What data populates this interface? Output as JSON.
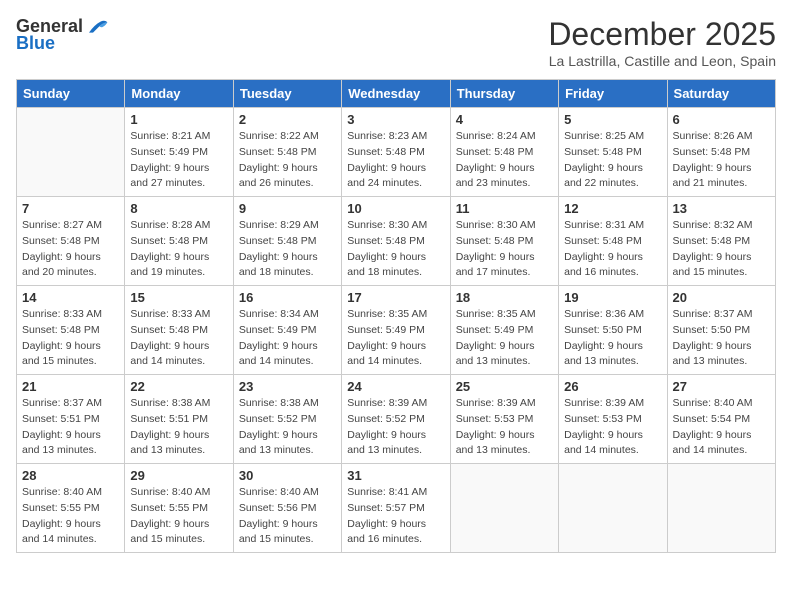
{
  "header": {
    "logo_general": "General",
    "logo_blue": "Blue",
    "month_title": "December 2025",
    "subtitle": "La Lastrilla, Castille and Leon, Spain"
  },
  "days_of_week": [
    "Sunday",
    "Monday",
    "Tuesday",
    "Wednesday",
    "Thursday",
    "Friday",
    "Saturday"
  ],
  "weeks": [
    [
      {
        "day": "",
        "info": ""
      },
      {
        "day": "1",
        "info": "Sunrise: 8:21 AM\nSunset: 5:49 PM\nDaylight: 9 hours\nand 27 minutes."
      },
      {
        "day": "2",
        "info": "Sunrise: 8:22 AM\nSunset: 5:48 PM\nDaylight: 9 hours\nand 26 minutes."
      },
      {
        "day": "3",
        "info": "Sunrise: 8:23 AM\nSunset: 5:48 PM\nDaylight: 9 hours\nand 24 minutes."
      },
      {
        "day": "4",
        "info": "Sunrise: 8:24 AM\nSunset: 5:48 PM\nDaylight: 9 hours\nand 23 minutes."
      },
      {
        "day": "5",
        "info": "Sunrise: 8:25 AM\nSunset: 5:48 PM\nDaylight: 9 hours\nand 22 minutes."
      },
      {
        "day": "6",
        "info": "Sunrise: 8:26 AM\nSunset: 5:48 PM\nDaylight: 9 hours\nand 21 minutes."
      }
    ],
    [
      {
        "day": "7",
        "info": "Sunrise: 8:27 AM\nSunset: 5:48 PM\nDaylight: 9 hours\nand 20 minutes."
      },
      {
        "day": "8",
        "info": "Sunrise: 8:28 AM\nSunset: 5:48 PM\nDaylight: 9 hours\nand 19 minutes."
      },
      {
        "day": "9",
        "info": "Sunrise: 8:29 AM\nSunset: 5:48 PM\nDaylight: 9 hours\nand 18 minutes."
      },
      {
        "day": "10",
        "info": "Sunrise: 8:30 AM\nSunset: 5:48 PM\nDaylight: 9 hours\nand 18 minutes."
      },
      {
        "day": "11",
        "info": "Sunrise: 8:30 AM\nSunset: 5:48 PM\nDaylight: 9 hours\nand 17 minutes."
      },
      {
        "day": "12",
        "info": "Sunrise: 8:31 AM\nSunset: 5:48 PM\nDaylight: 9 hours\nand 16 minutes."
      },
      {
        "day": "13",
        "info": "Sunrise: 8:32 AM\nSunset: 5:48 PM\nDaylight: 9 hours\nand 15 minutes."
      }
    ],
    [
      {
        "day": "14",
        "info": "Sunrise: 8:33 AM\nSunset: 5:48 PM\nDaylight: 9 hours\nand 15 minutes."
      },
      {
        "day": "15",
        "info": "Sunrise: 8:33 AM\nSunset: 5:48 PM\nDaylight: 9 hours\nand 14 minutes."
      },
      {
        "day": "16",
        "info": "Sunrise: 8:34 AM\nSunset: 5:49 PM\nDaylight: 9 hours\nand 14 minutes."
      },
      {
        "day": "17",
        "info": "Sunrise: 8:35 AM\nSunset: 5:49 PM\nDaylight: 9 hours\nand 14 minutes."
      },
      {
        "day": "18",
        "info": "Sunrise: 8:35 AM\nSunset: 5:49 PM\nDaylight: 9 hours\nand 13 minutes."
      },
      {
        "day": "19",
        "info": "Sunrise: 8:36 AM\nSunset: 5:50 PM\nDaylight: 9 hours\nand 13 minutes."
      },
      {
        "day": "20",
        "info": "Sunrise: 8:37 AM\nSunset: 5:50 PM\nDaylight: 9 hours\nand 13 minutes."
      }
    ],
    [
      {
        "day": "21",
        "info": "Sunrise: 8:37 AM\nSunset: 5:51 PM\nDaylight: 9 hours\nand 13 minutes."
      },
      {
        "day": "22",
        "info": "Sunrise: 8:38 AM\nSunset: 5:51 PM\nDaylight: 9 hours\nand 13 minutes."
      },
      {
        "day": "23",
        "info": "Sunrise: 8:38 AM\nSunset: 5:52 PM\nDaylight: 9 hours\nand 13 minutes."
      },
      {
        "day": "24",
        "info": "Sunrise: 8:39 AM\nSunset: 5:52 PM\nDaylight: 9 hours\nand 13 minutes."
      },
      {
        "day": "25",
        "info": "Sunrise: 8:39 AM\nSunset: 5:53 PM\nDaylight: 9 hours\nand 13 minutes."
      },
      {
        "day": "26",
        "info": "Sunrise: 8:39 AM\nSunset: 5:53 PM\nDaylight: 9 hours\nand 14 minutes."
      },
      {
        "day": "27",
        "info": "Sunrise: 8:40 AM\nSunset: 5:54 PM\nDaylight: 9 hours\nand 14 minutes."
      }
    ],
    [
      {
        "day": "28",
        "info": "Sunrise: 8:40 AM\nSunset: 5:55 PM\nDaylight: 9 hours\nand 14 minutes."
      },
      {
        "day": "29",
        "info": "Sunrise: 8:40 AM\nSunset: 5:55 PM\nDaylight: 9 hours\nand 15 minutes."
      },
      {
        "day": "30",
        "info": "Sunrise: 8:40 AM\nSunset: 5:56 PM\nDaylight: 9 hours\nand 15 minutes."
      },
      {
        "day": "31",
        "info": "Sunrise: 8:41 AM\nSunset: 5:57 PM\nDaylight: 9 hours\nand 16 minutes."
      },
      {
        "day": "",
        "info": ""
      },
      {
        "day": "",
        "info": ""
      },
      {
        "day": "",
        "info": ""
      }
    ]
  ]
}
